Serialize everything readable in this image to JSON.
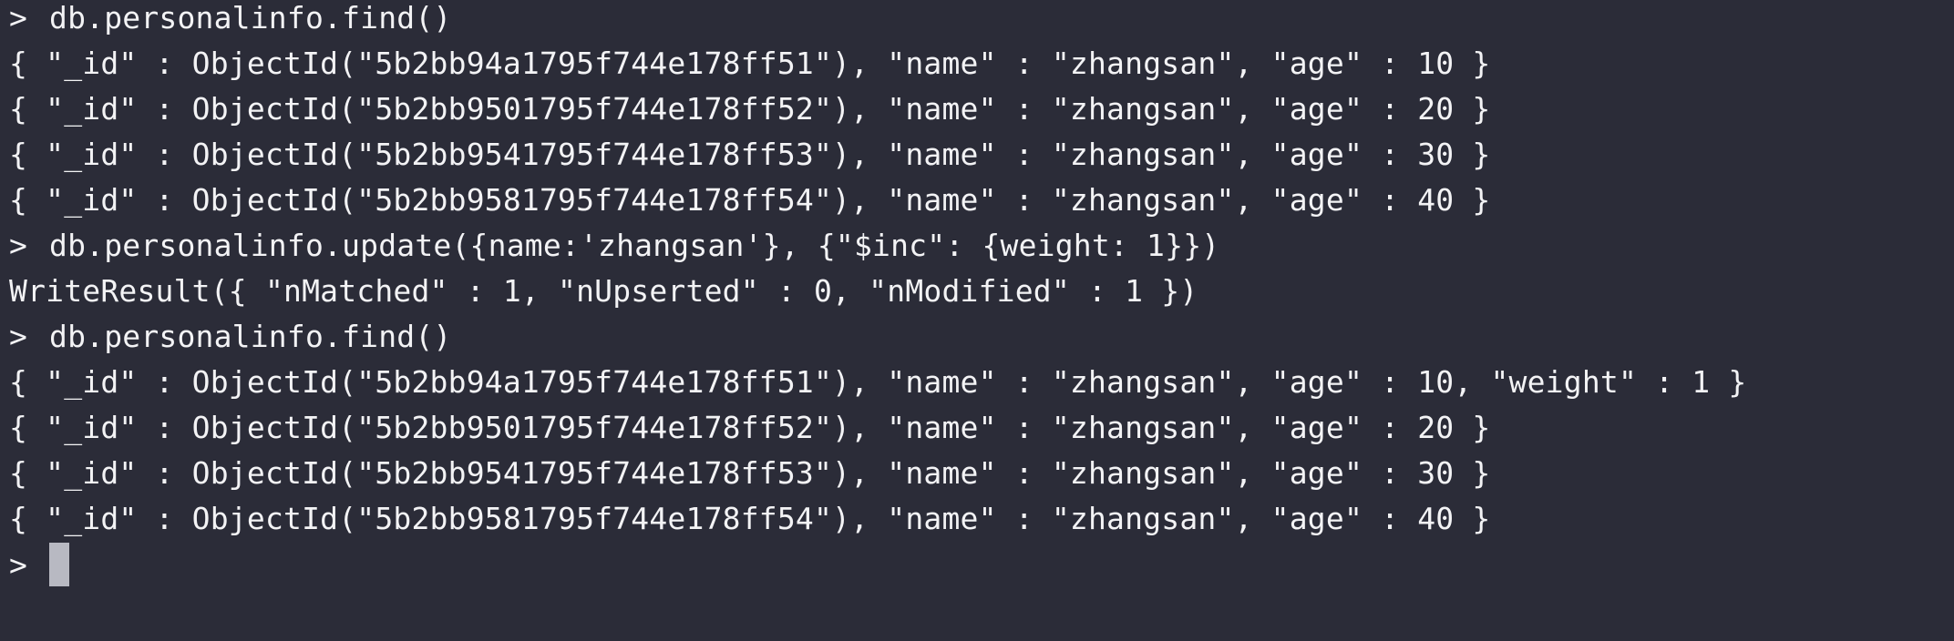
{
  "terminal": {
    "background": "#2b2c38",
    "foreground": "#f3f3f5",
    "cursor_color": "#b8b9c2",
    "lines": [
      {
        "prompt": ">",
        "text": "db.personalinfo.find()"
      },
      {
        "prompt": "",
        "text": "{ \"_id\" : ObjectId(\"5b2bb94a1795f744e178ff51\"), \"name\" : \"zhangsan\", \"age\" : 10 }"
      },
      {
        "prompt": "",
        "text": "{ \"_id\" : ObjectId(\"5b2bb9501795f744e178ff52\"), \"name\" : \"zhangsan\", \"age\" : 20 }"
      },
      {
        "prompt": "",
        "text": "{ \"_id\" : ObjectId(\"5b2bb9541795f744e178ff53\"), \"name\" : \"zhangsan\", \"age\" : 30 }"
      },
      {
        "prompt": "",
        "text": "{ \"_id\" : ObjectId(\"5b2bb9581795f744e178ff54\"), \"name\" : \"zhangsan\", \"age\" : 40 }"
      },
      {
        "prompt": ">",
        "text": "db.personalinfo.update({name:'zhangsan'}, {\"$inc\": {weight: 1}})"
      },
      {
        "prompt": "",
        "text": "WriteResult({ \"nMatched\" : 1, \"nUpserted\" : 0, \"nModified\" : 1 })"
      },
      {
        "prompt": ">",
        "text": "db.personalinfo.find()"
      },
      {
        "prompt": "",
        "text": "{ \"_id\" : ObjectId(\"5b2bb94a1795f744e178ff51\"), \"name\" : \"zhangsan\", \"age\" : 10, \"weight\" : 1 }"
      },
      {
        "prompt": "",
        "text": "{ \"_id\" : ObjectId(\"5b2bb9501795f744e178ff52\"), \"name\" : \"zhangsan\", \"age\" : 20 }"
      },
      {
        "prompt": "",
        "text": "{ \"_id\" : ObjectId(\"5b2bb9541795f744e178ff53\"), \"name\" : \"zhangsan\", \"age\" : 30 }"
      },
      {
        "prompt": "",
        "text": "{ \"_id\" : ObjectId(\"5b2bb9581795f744e178ff54\"), \"name\" : \"zhangsan\", \"age\" : 40 }"
      }
    ],
    "current_prompt": ">"
  }
}
